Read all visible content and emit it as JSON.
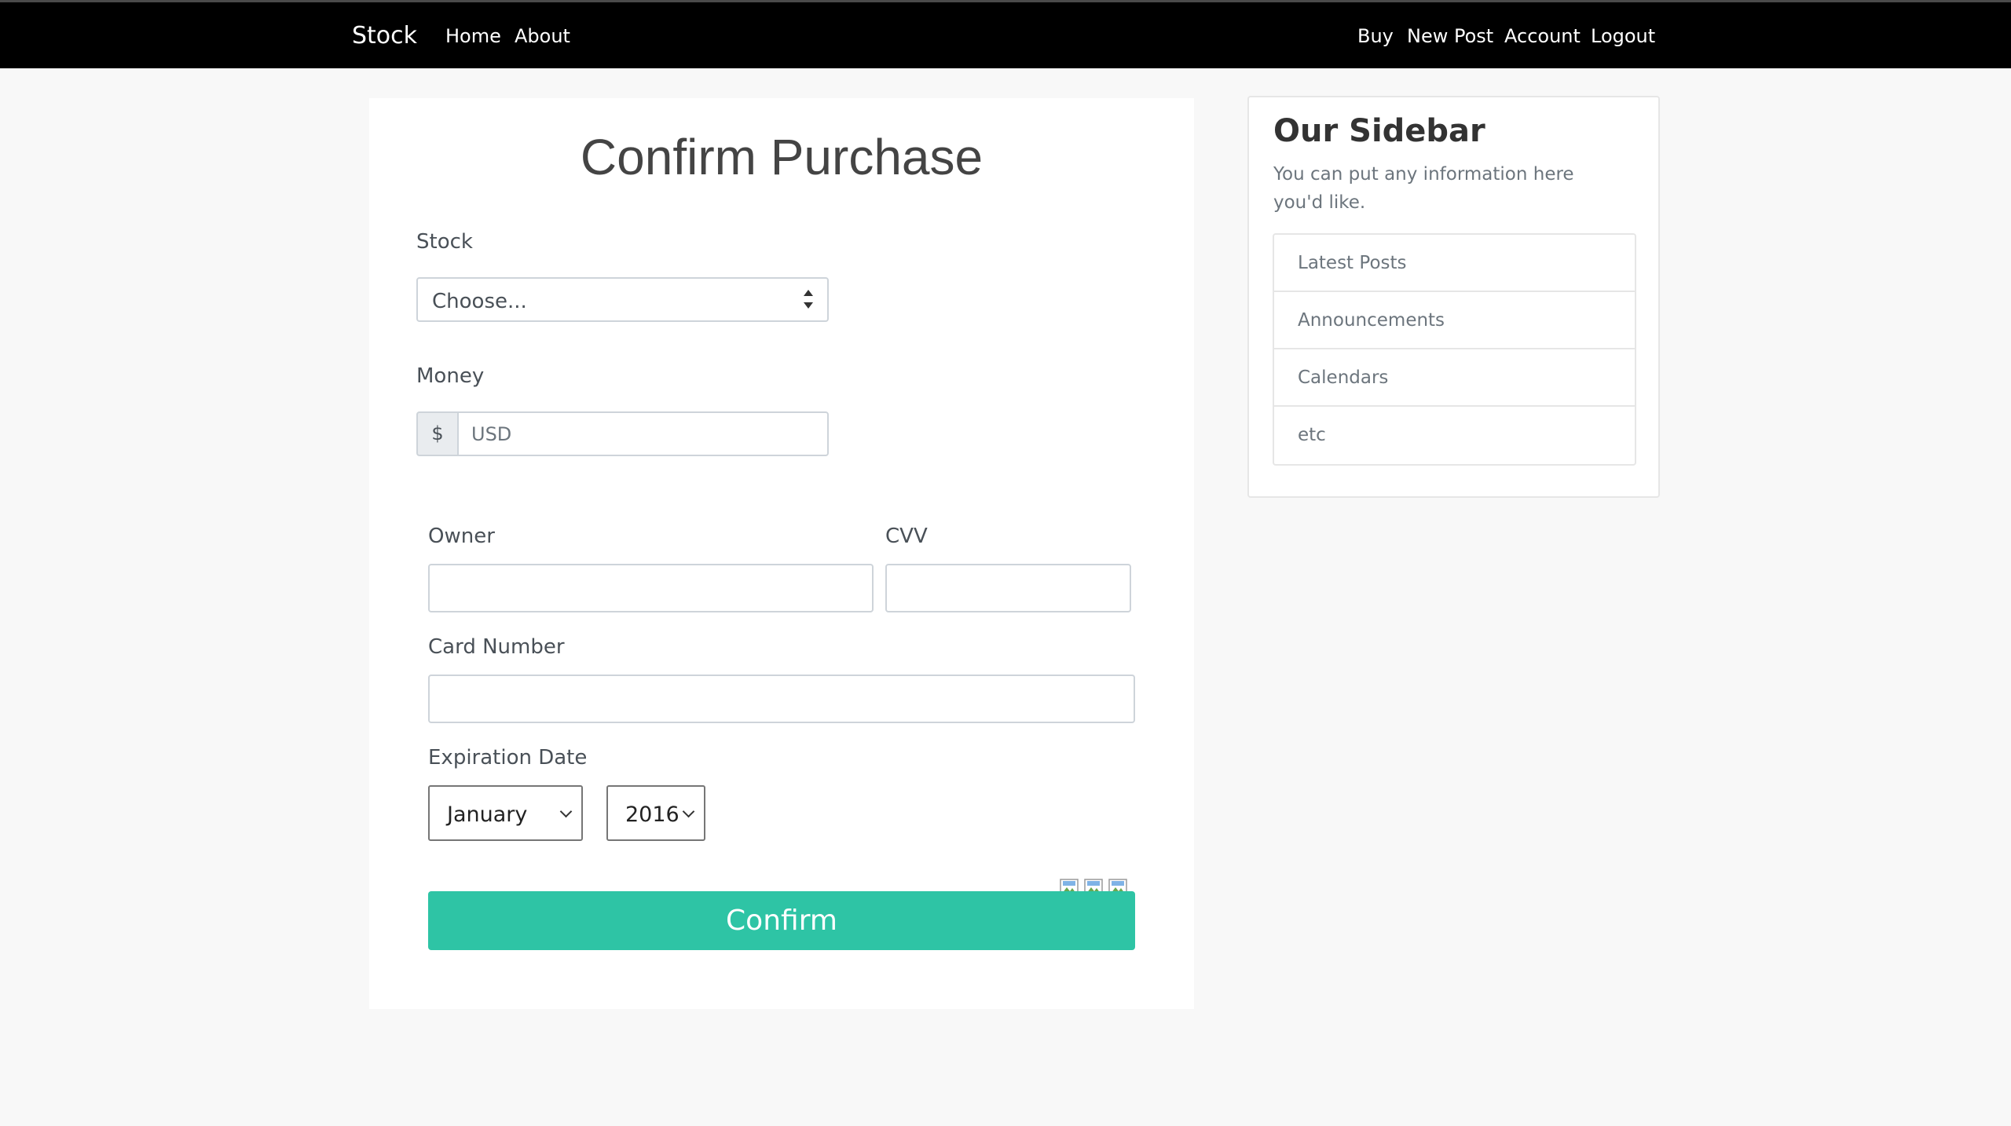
{
  "navbar": {
    "brand": "Stock",
    "left_links": [
      "Home",
      "About"
    ],
    "right_links": [
      "Buy",
      "New Post",
      "Account",
      "Logout"
    ]
  },
  "form": {
    "title": "Confirm Purchase",
    "stock_label": "Stock",
    "stock_selected": "Choose...",
    "money_label": "Money",
    "money_addon": "$",
    "money_placeholder": "USD",
    "owner_label": "Owner",
    "cvv_label": "CVV",
    "card_number_label": "Card Number",
    "expiration_label": "Expiration Date",
    "month_selected": "January",
    "year_selected": "2016",
    "card_icons": [
      "broken-image-icon",
      "broken-image-icon",
      "broken-image-icon"
    ],
    "confirm_label": "Confirm",
    "accent_color": "#2ec4a5"
  },
  "sidebar": {
    "title": "Our Sidebar",
    "description": "You can put any information here you'd like.",
    "items": [
      "Latest Posts",
      "Announcements",
      "Calendars",
      "etc"
    ]
  }
}
